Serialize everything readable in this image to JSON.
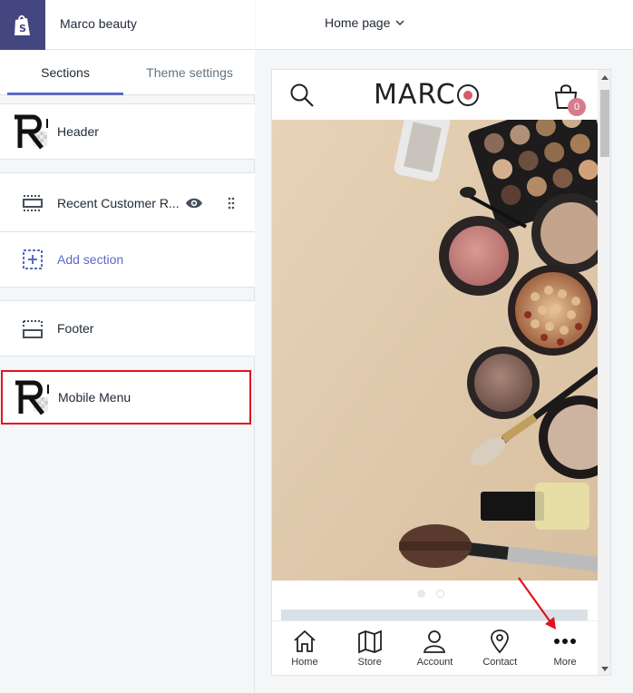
{
  "store": {
    "name": "Marco beauty"
  },
  "page_selector": {
    "label": "Home page"
  },
  "tabs": [
    {
      "label": "Sections",
      "active": true
    },
    {
      "label": "Theme settings",
      "active": false
    }
  ],
  "sections": {
    "header": "Header",
    "recent": "Recent Customer R...",
    "add": "Add section",
    "footer": "Footer",
    "mobile_menu": "Mobile Menu"
  },
  "preview": {
    "brand": "MARC",
    "cart_count": "0",
    "nav": [
      {
        "label": "Home",
        "icon": "home-icon"
      },
      {
        "label": "Store",
        "icon": "map-icon"
      },
      {
        "label": "Account",
        "icon": "user-icon"
      },
      {
        "label": "Contact",
        "icon": "location-pin-icon"
      },
      {
        "label": "More",
        "icon": "more-icon"
      }
    ]
  },
  "colors": {
    "accent": "#5c6ac4",
    "shopify_bar": "#43467f",
    "highlight": "#e0141e",
    "badge": "#d87b8c"
  }
}
